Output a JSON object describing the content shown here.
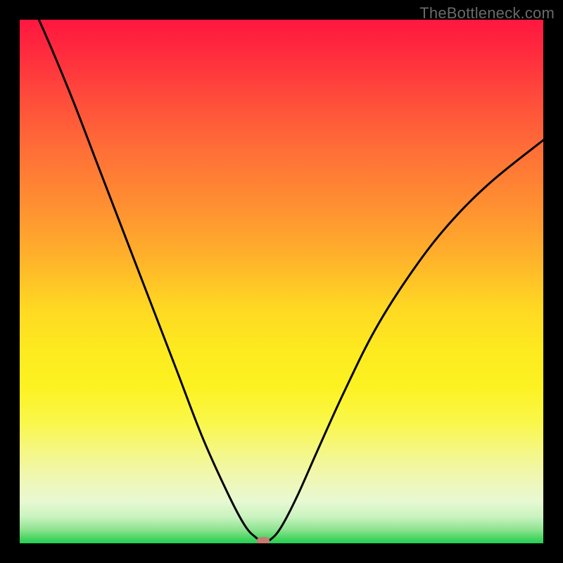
{
  "watermark": "TheBottleneck.com",
  "chart_data": {
    "type": "line",
    "title": "",
    "xlabel": "",
    "ylabel": "",
    "xlim": [
      0,
      100
    ],
    "ylim": [
      0,
      100
    ],
    "grid": false,
    "legend": false,
    "series": [
      {
        "name": "bottleneck-curve",
        "x": [
          0,
          5,
          10,
          15,
          20,
          25,
          30,
          35,
          40,
          43,
          45,
          46.5,
          48,
          50,
          53,
          57,
          62,
          68,
          75,
          82,
          90,
          100
        ],
        "y": [
          108,
          97,
          85,
          72,
          59,
          46,
          33,
          20,
          9,
          3.4,
          1.2,
          0.4,
          0.8,
          3.2,
          9,
          18,
          29,
          41,
          52,
          61,
          69,
          77
        ]
      }
    ],
    "min_point": {
      "x": 46.5,
      "y": 0.4
    },
    "marker_color": "#c77a71",
    "curve_color": "#000000",
    "background_gradient": {
      "top": "#ff173f",
      "mid1": "#ffb02b",
      "mid2": "#fcf221",
      "bottom": "#24cf55"
    }
  }
}
